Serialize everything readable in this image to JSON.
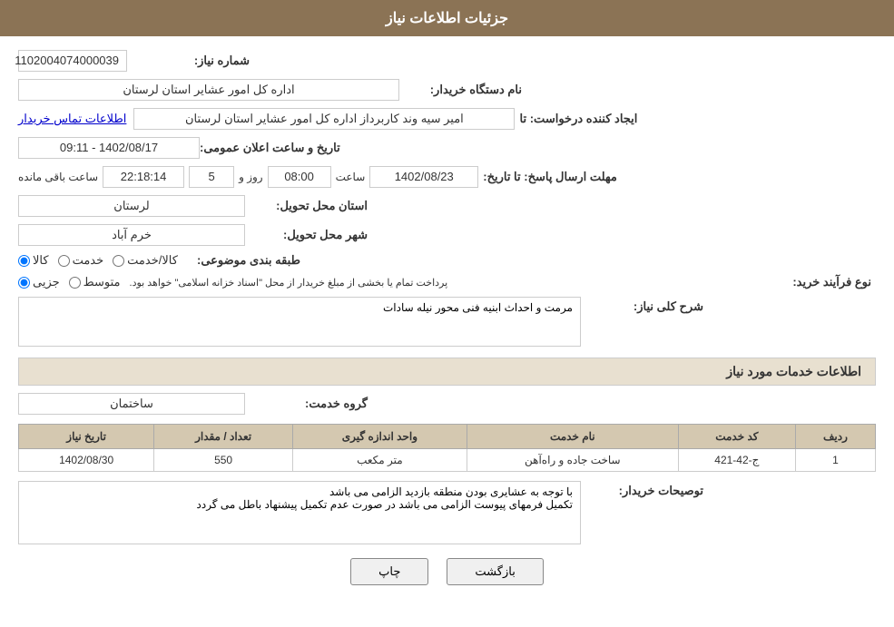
{
  "header": {
    "title": "جزئیات اطلاعات نیاز"
  },
  "fields": {
    "need_number_label": "شماره نیاز:",
    "need_number_value": "1102004074000039",
    "buyer_org_label": "نام دستگاه خریدار:",
    "buyer_org_value": "اداره کل امور عشایر استان لرستان",
    "announcement_label": "تاریخ و ساعت اعلان عمومی:",
    "announcement_value": "1402/08/17 - 09:11",
    "creator_label": "ایجاد کننده درخواست: تا",
    "creator_value": "امیر سیه وند کاربرداز اداره کل امور عشایر استان لرستان",
    "contact_link": "اطلاعات تماس خریدار",
    "deadline_label": "مهلت ارسال پاسخ: تا تاریخ:",
    "deadline_date": "1402/08/23",
    "deadline_time_label": "ساعت",
    "deadline_time": "08:00",
    "deadline_days_label": "روز و",
    "deadline_days": "5",
    "deadline_remaining_label": "ساعت باقی مانده",
    "deadline_remaining": "22:18:14",
    "province_label": "استان محل تحویل:",
    "province_value": "لرستان",
    "city_label": "شهر محل تحویل:",
    "city_value": "خرم آباد",
    "category_label": "طبقه بندی موضوعی:",
    "category_kala": "کالا",
    "category_khadamat": "خدمت",
    "category_kala_khadamat": "کالا/خدمت",
    "process_label": "نوع فرآیند خرید:",
    "process_jozei": "جزیی",
    "process_motovaset": "متوسط",
    "process_note": "پرداخت تمام یا بخشی از مبلغ خریدار از محل \"اسناد خزانه اسلامی\" خواهد بود.",
    "description_label": "شرح کلی نیاز:",
    "description_value": "مرمت و احداث ابنیه فنی محور نیله سادات",
    "services_section_title": "اطلاعات خدمات مورد نیاز",
    "service_group_label": "گروه خدمت:",
    "service_group_value": "ساختمان",
    "table_headers": {
      "row_num": "ردیف",
      "service_code": "کد خدمت",
      "service_name": "نام خدمت",
      "unit": "واحد اندازه گیری",
      "qty": "تعداد / مقدار",
      "date": "تاریخ نیاز"
    },
    "table_rows": [
      {
        "row_num": "1",
        "service_code": "ج-42-421",
        "service_name": "ساخت جاده و راه‌آهن",
        "unit": "متر مکعب",
        "qty": "550",
        "date": "1402/08/30"
      }
    ],
    "buyer_notes_label": "توصیحات خریدار:",
    "buyer_notes_value": "با توجه به عشایری بودن منطقه بازدید الزامی می باشد\nتکمیل فرمهای پیوست الزامی می باشد در صورت عدم تکمیل پیشنهاد باطل می گردد"
  },
  "buttons": {
    "print": "چاپ",
    "back": "بازگشت"
  }
}
